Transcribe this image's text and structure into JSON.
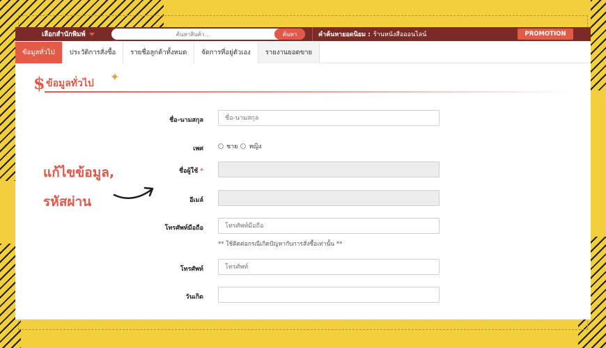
{
  "topbar": {
    "publisher_label": "เลือกสำนักพิมพ์",
    "search_placeholder": "ค้นหาสินค้า...",
    "search_button": "ค้นหา",
    "popular_label": "คำค้นหายอดนิยม :",
    "popular_value": "ร้านหนังสือออนไลน์",
    "promotion_label": "PROMOTION"
  },
  "tabs": [
    {
      "label": "ข้อมูลทั่วไป",
      "active": true
    },
    {
      "label": "ประวัติการสั่งซื้อ",
      "active": false
    },
    {
      "label": "รายชื่อลูกค้าทั้งหมด",
      "active": false
    },
    {
      "label": "จัดการที่อยู่ตัวเอง",
      "active": false
    },
    {
      "label": "รายงานยอดขาย",
      "active": false
    }
  ],
  "section": {
    "title": "ข้อมูลทั่วไป",
    "logo_glyph": "$",
    "spark_glyph": "✦"
  },
  "form": {
    "name_label": "ชื่อ-นามสกุล",
    "name_placeholder": "ชื่อ-นามสกุล",
    "gender_label": "เพศ",
    "gender_male": "ชาย",
    "gender_female": "หญิง",
    "username_label": "ชื่อผู้ใช้",
    "required_mark": "*",
    "email_label": "อีเมล์",
    "email_value": "",
    "mobile_label": "โทรศัพท์มือถือ",
    "mobile_placeholder": "โทรศัพท์มือถือ",
    "mobile_hint": "** ใช้ติดต่อกรณีเกิดปัญหากับการสั่งซื้อเท่านั้น **",
    "phone_label": "โทรศัพท์",
    "phone_placeholder": "โทรศัพท์",
    "birthday_label": "วันเกิด"
  },
  "annotation": {
    "line1": "แก้ไขข้อมูล,",
    "line2": "รหัสผ่าน"
  },
  "colors": {
    "accent": "#e0594a",
    "topbar": "#7a2b27",
    "background": "#f4cf3c"
  }
}
